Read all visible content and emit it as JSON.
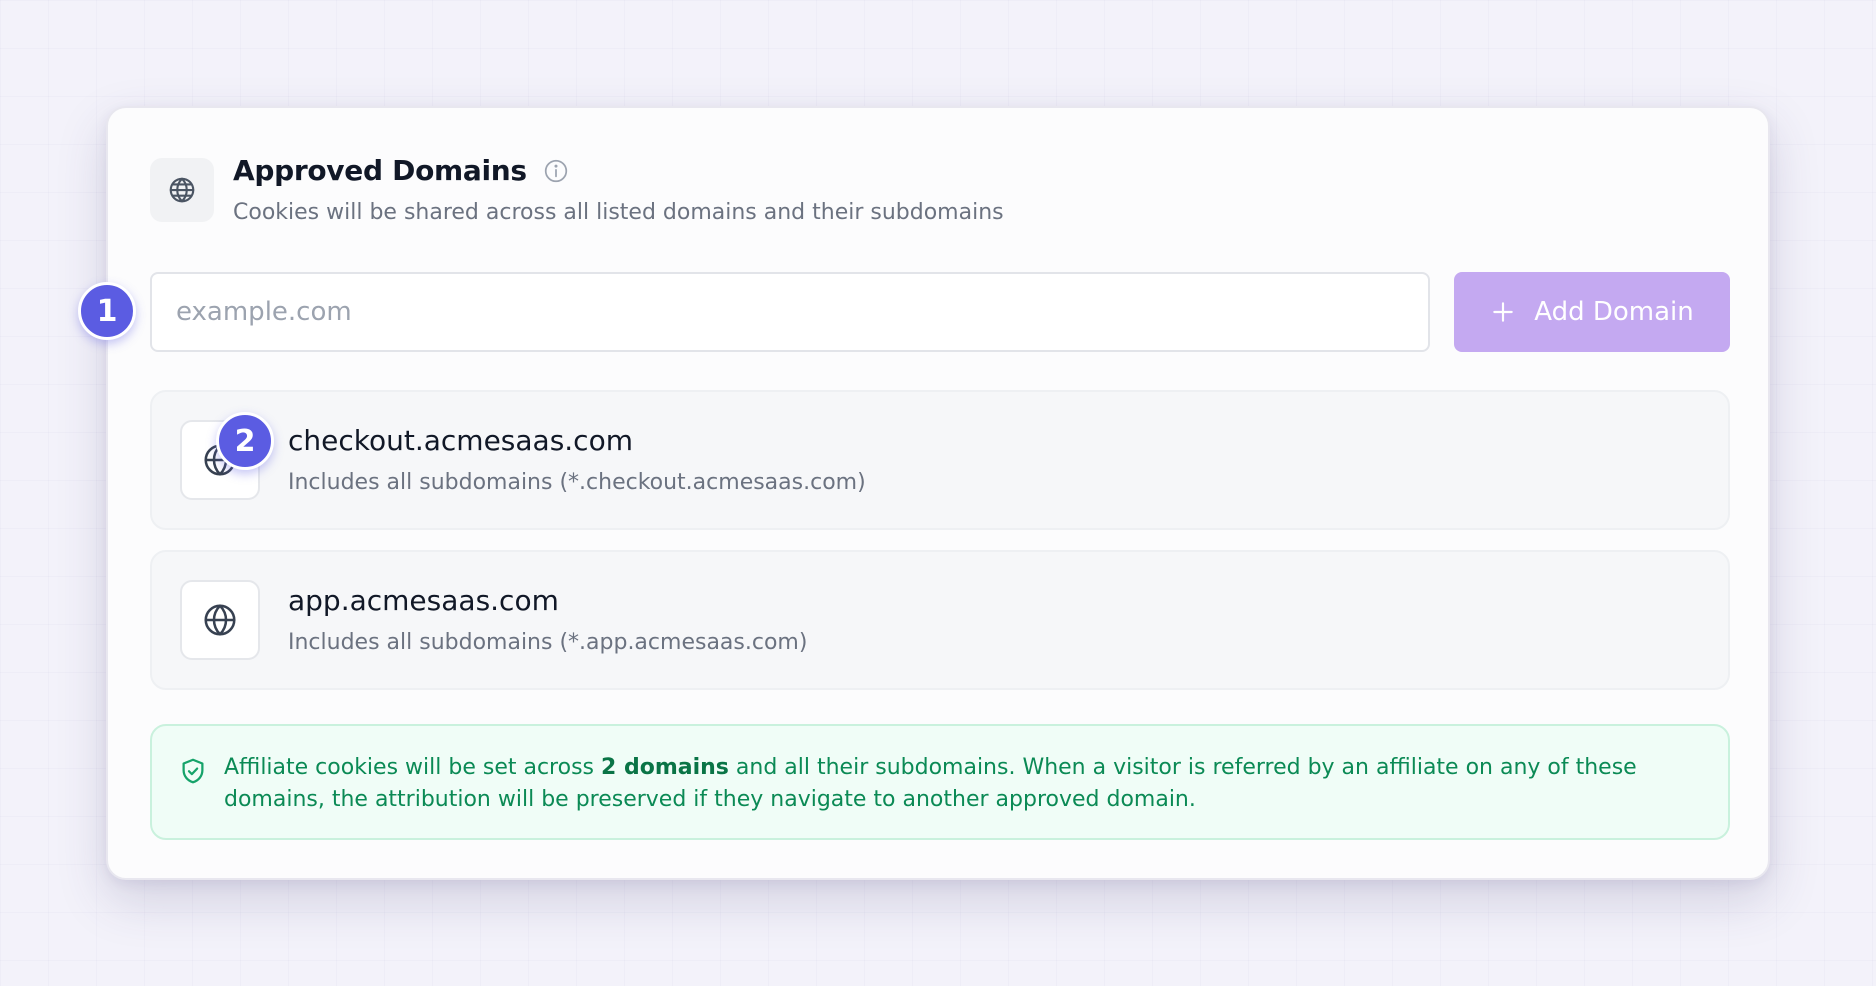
{
  "header": {
    "title": "Approved Domains",
    "subtitle": "Cookies will be shared across all listed domains and their subdomains",
    "icon": "globe-icon",
    "info_icon": "info-icon"
  },
  "add_form": {
    "input_value": "",
    "input_placeholder": "example.com",
    "button_label": "Add Domain",
    "button_icon": "plus-icon"
  },
  "badges": [
    "1",
    "2"
  ],
  "domains": [
    {
      "name": "checkout.acmesaas.com",
      "subtitle": "Includes all subdomains (*.checkout.acmesaas.com)",
      "icon": "globe-icon"
    },
    {
      "name": "app.acmesaas.com",
      "subtitle": "Includes all subdomains (*.app.acmesaas.com)",
      "icon": "globe-icon"
    }
  ],
  "notice": {
    "icon": "shield-check-icon",
    "text_before": "Affiliate cookies will be set across ",
    "count_text": "2 domains",
    "text_after": " and all their subdomains. When a visitor is referred by an affiliate on any of these domains, the attribution will be preserved if they navigate to another approved domain."
  },
  "colors": {
    "accent": "#5b5ce2",
    "button_bg": "#c4a9f1",
    "notice_bg": "#f0fdf7",
    "notice_text": "#0b8a55"
  }
}
